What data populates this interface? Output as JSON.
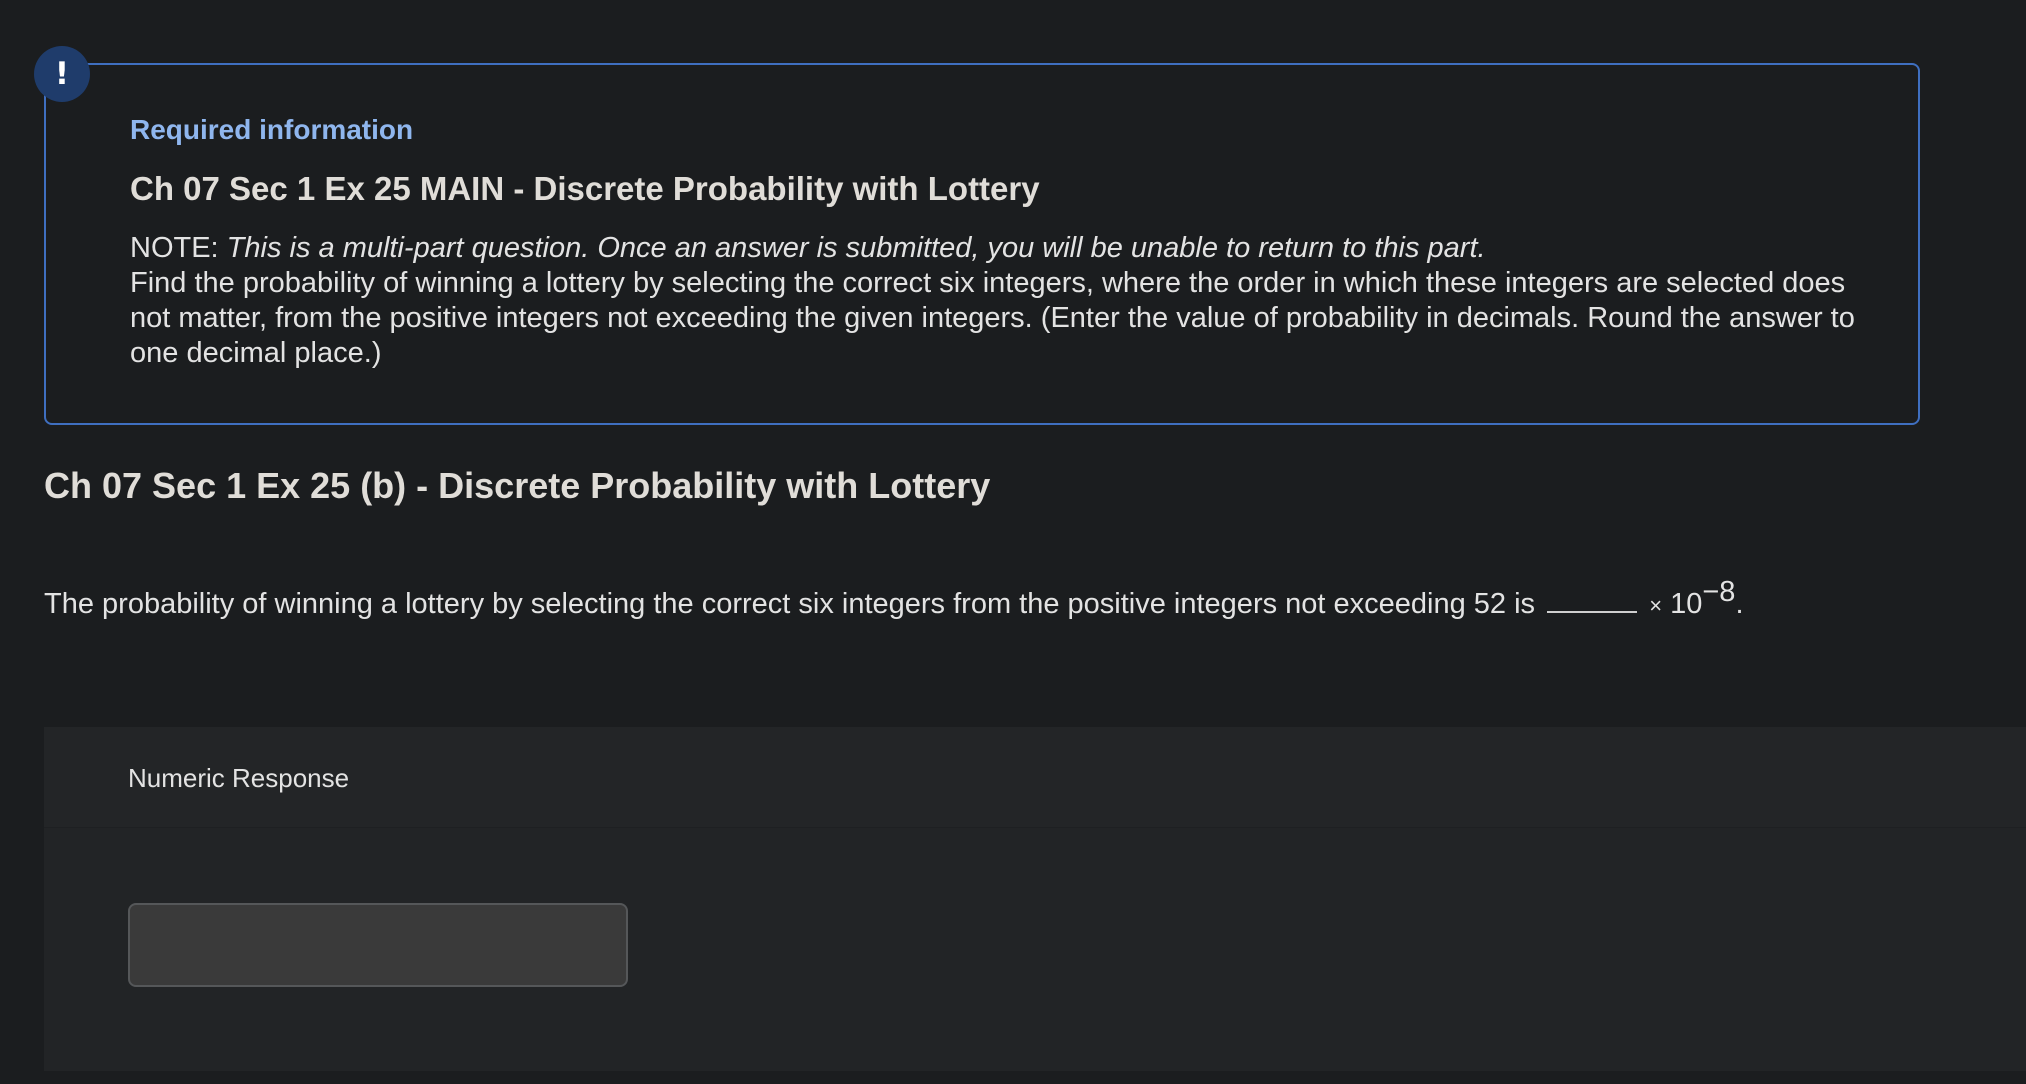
{
  "alert": {
    "symbol": "!"
  },
  "info_box": {
    "label": "Required information",
    "title": "Ch 07 Sec 1 Ex 25 MAIN - Discrete Probability with Lottery",
    "note_prefix": "NOTE: ",
    "note_text": "This is a multi-part question. Once an answer is submitted, you will be unable to return to this part.",
    "instructions": "Find the probability of winning a lottery by selecting the correct six integers, where the order in which these integers are selected does not matter, from the positive integers not exceeding the given integers. (Enter the value of probability in decimals. Round the answer to one decimal place.)"
  },
  "section": {
    "title": "Ch 07 Sec 1 Ex 25 (b) - Discrete Probability with Lottery"
  },
  "question": {
    "text": "The probability of winning a lottery by selecting the correct six integers from the positive integers not exceeding 52 is",
    "times": "×",
    "base": "10",
    "exponent": "−8",
    "end": "."
  },
  "response": {
    "label": "Numeric Response",
    "value": ""
  }
}
